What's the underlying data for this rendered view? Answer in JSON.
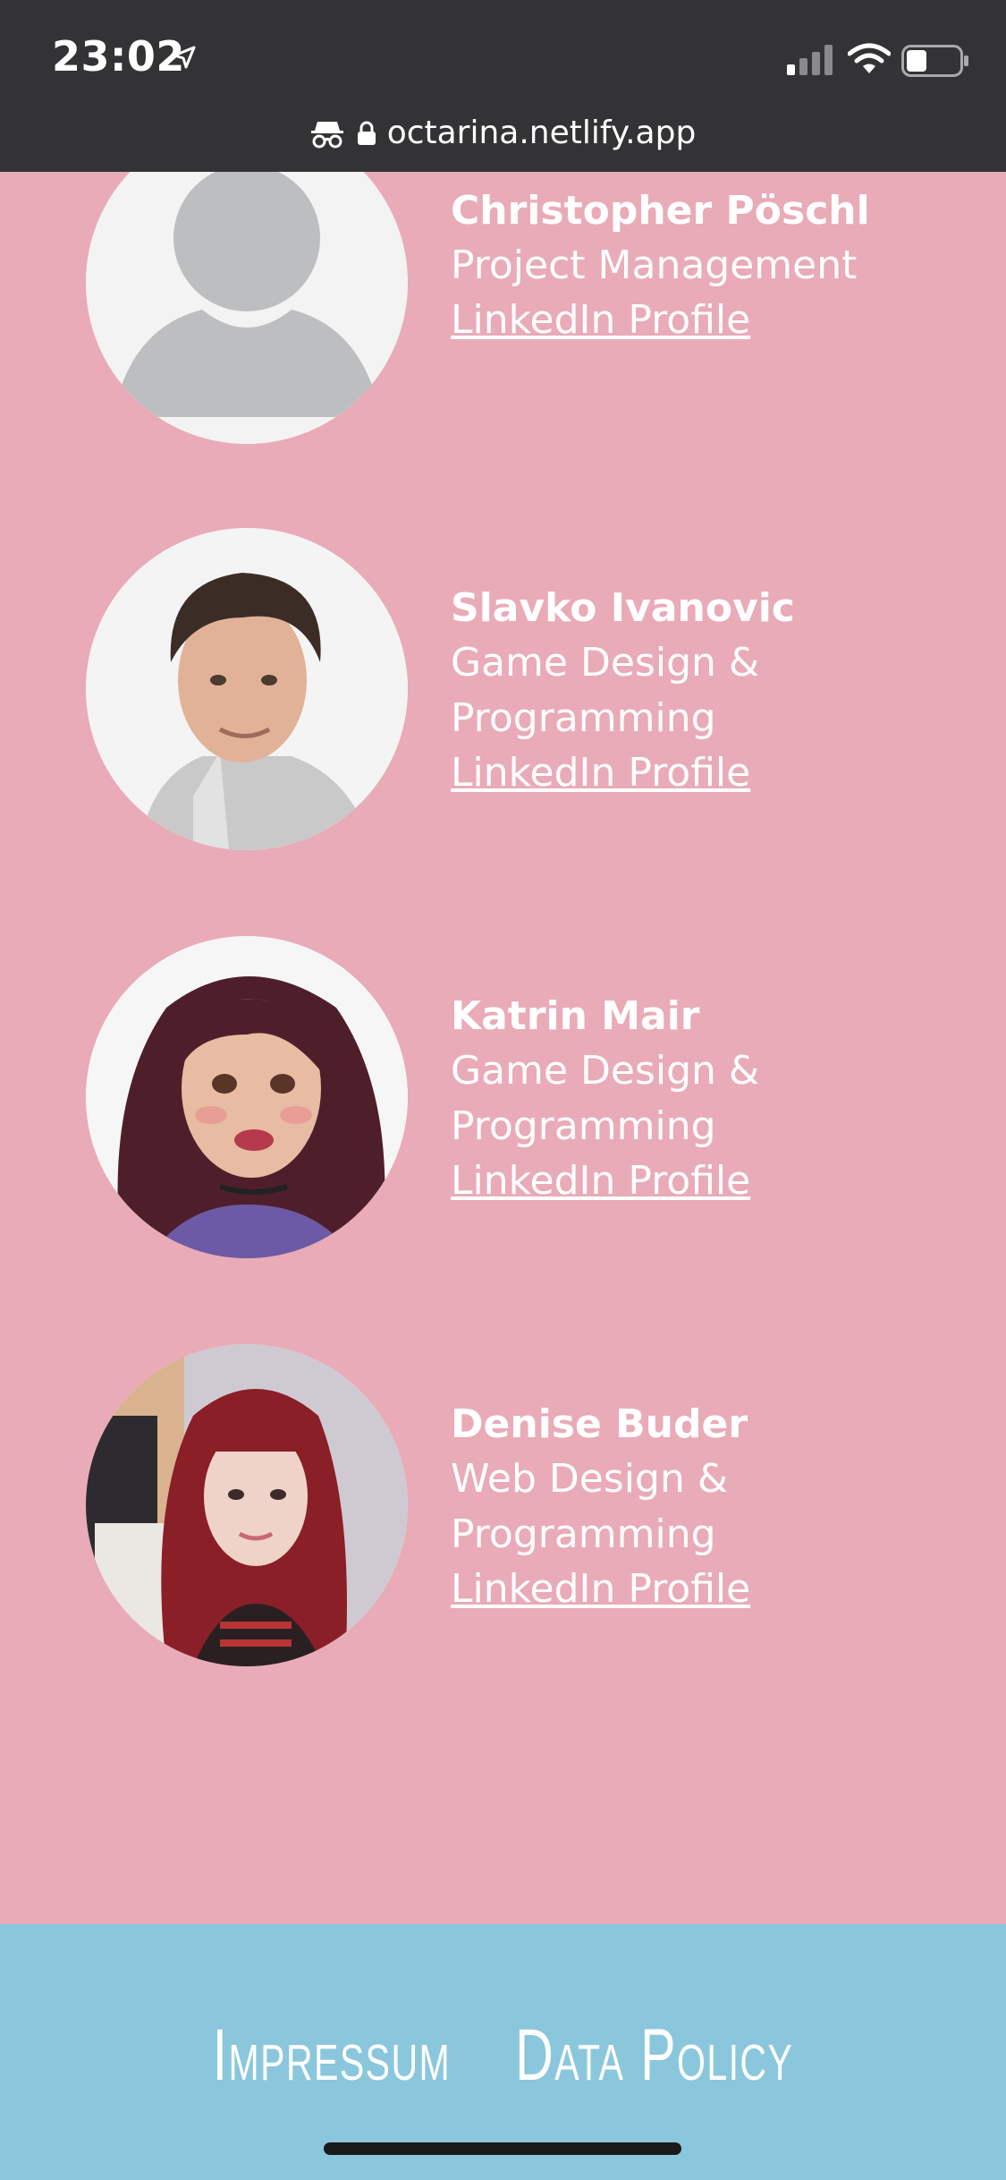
{
  "status_bar": {
    "time": "23:02",
    "url": "octarina.netlify.app"
  },
  "team": [
    {
      "name": "Christopher Pöschl",
      "role": "Project Management",
      "link": "LinkedIn Profile",
      "avatar": "placeholder-person-icon"
    },
    {
      "name": "Slavko Ivanovic",
      "role": "Game Design & Programming",
      "link": "LinkedIn Profile",
      "avatar": "photo"
    },
    {
      "name": "Katrin Mair",
      "role": "Game Design & Programming",
      "link": "LinkedIn Profile",
      "avatar": "illustration"
    },
    {
      "name": "Denise Buder",
      "role": "Web Design & Programming",
      "link": "LinkedIn Profile",
      "avatar": "photo"
    }
  ],
  "footer": {
    "impressum": "Impressum",
    "data_policy": "Data Policy"
  },
  "colors": {
    "background": "#e9abb7",
    "footer": "#8ac7dd",
    "chrome": "#333335"
  }
}
